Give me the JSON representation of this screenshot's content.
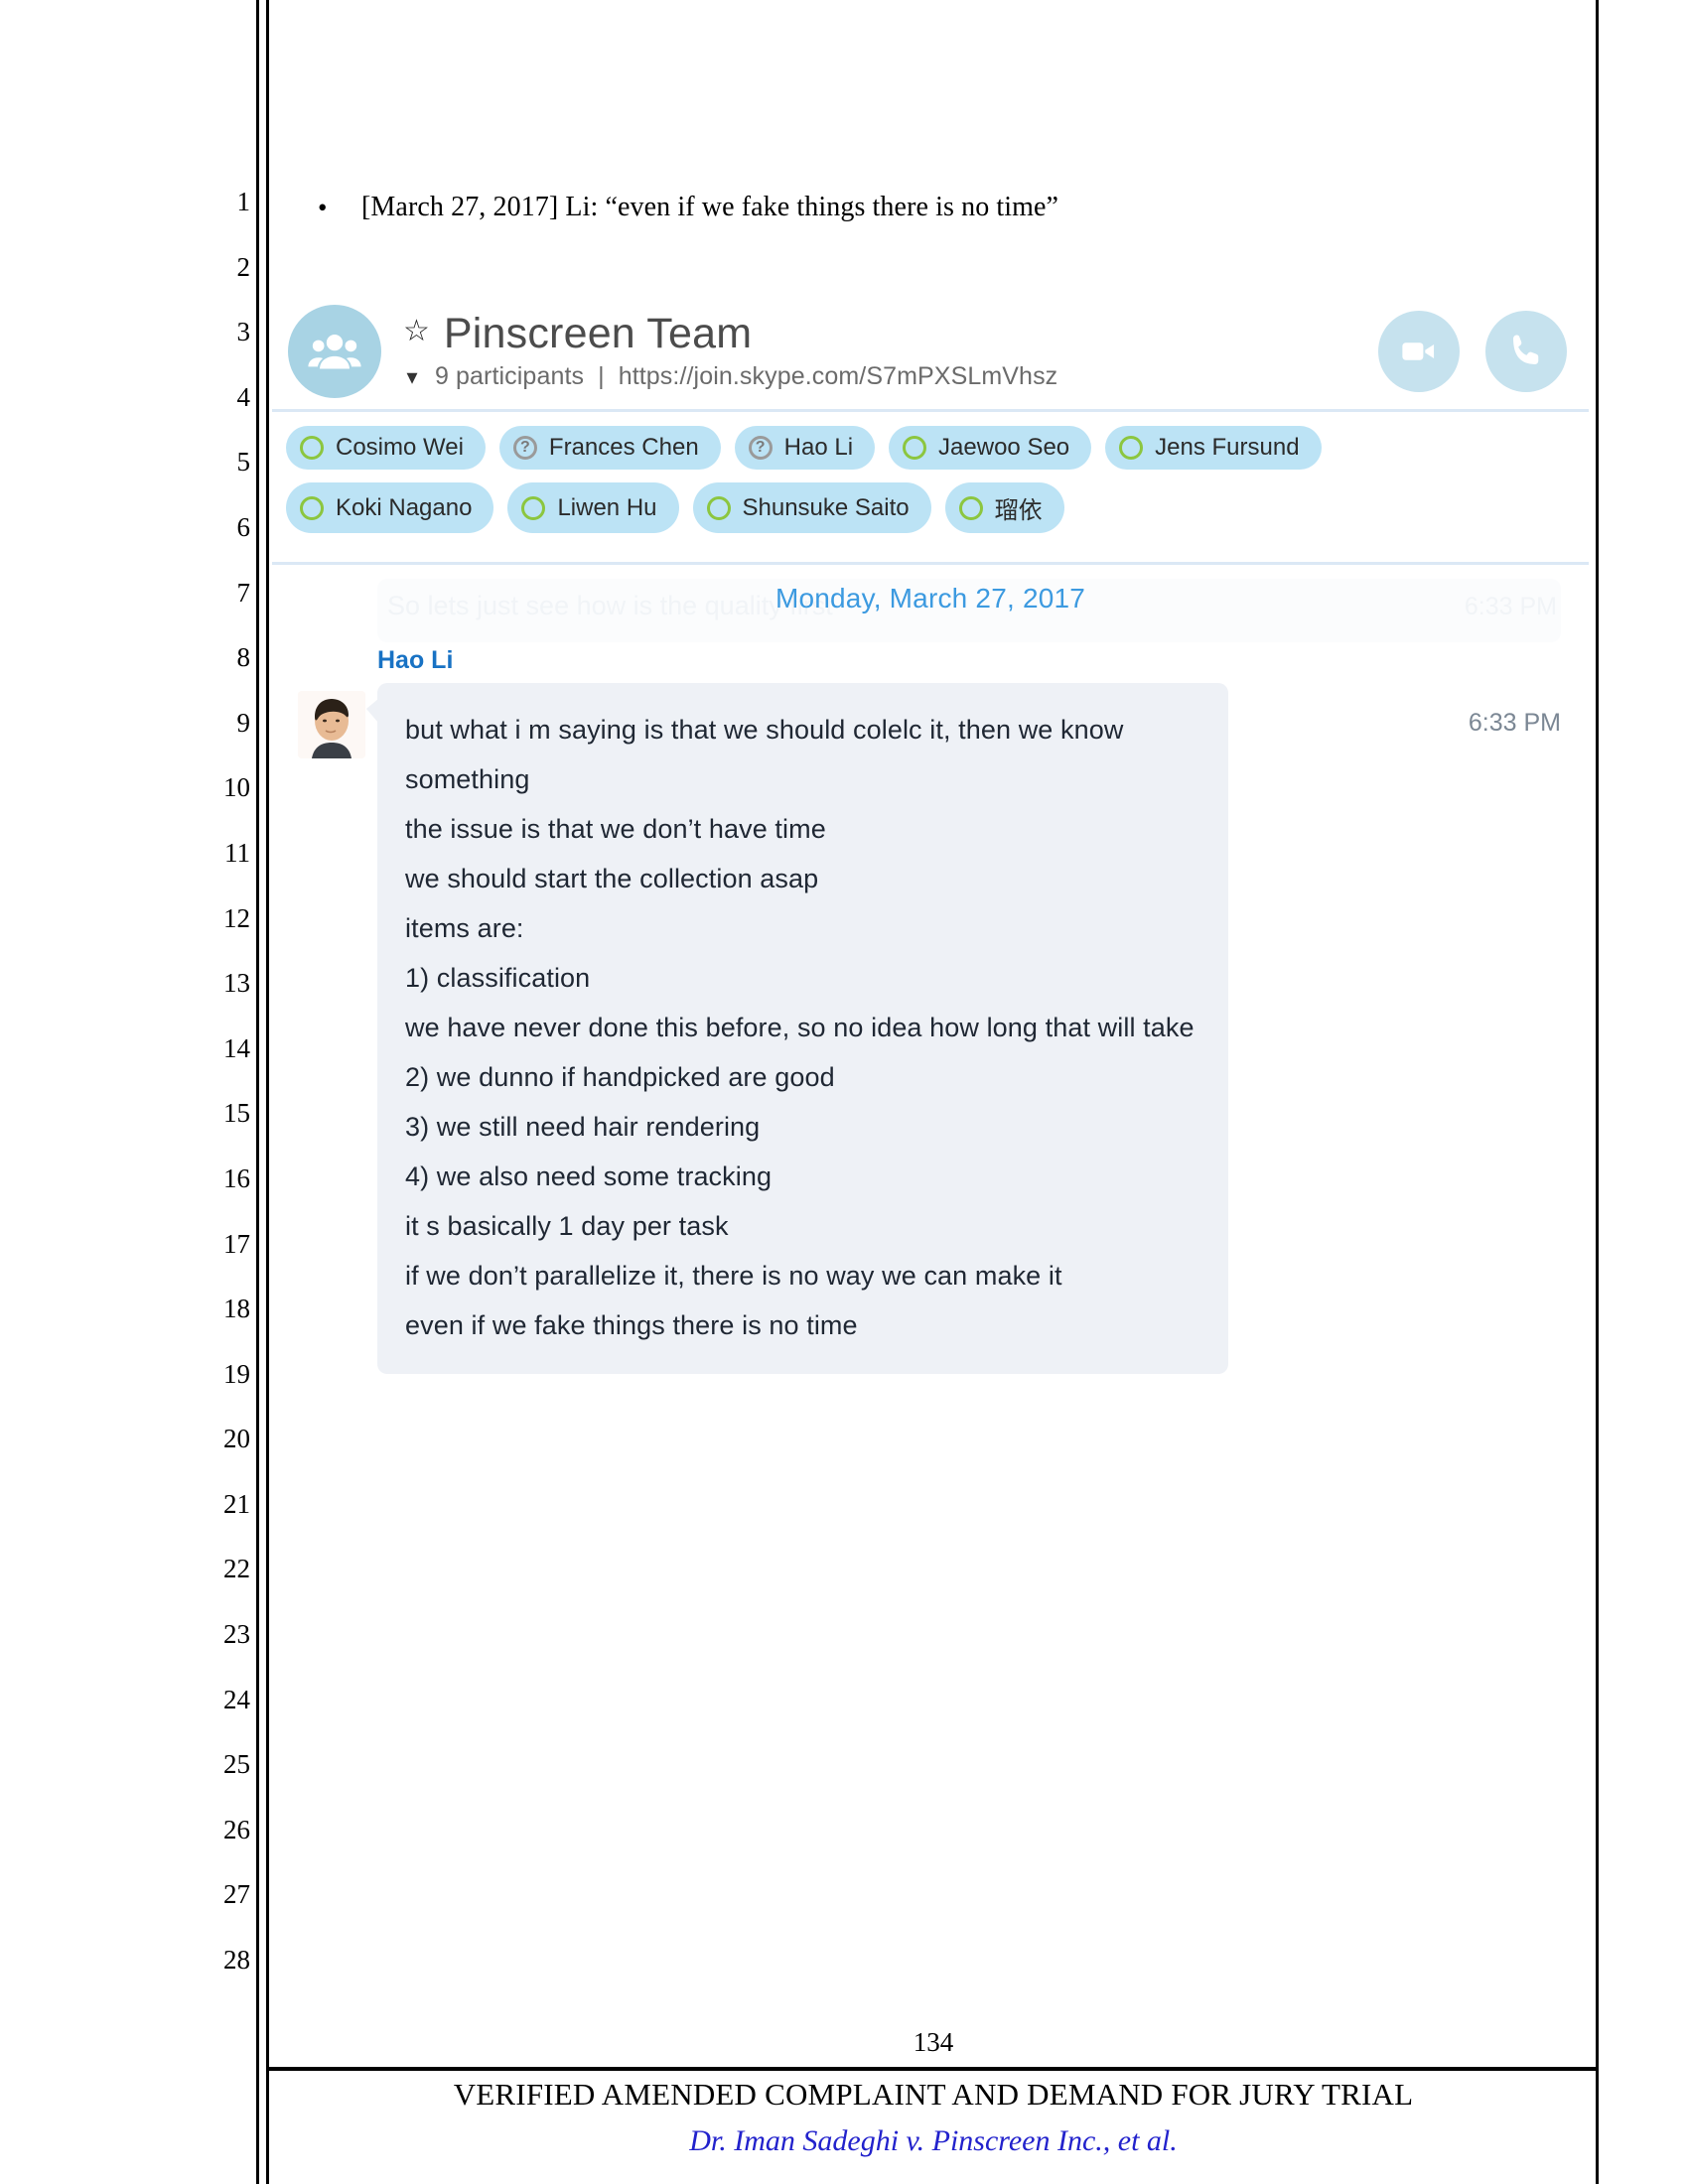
{
  "document": {
    "line_numbers": [
      "1",
      "2",
      "3",
      "4",
      "5",
      "6",
      "7",
      "8",
      "9",
      "10",
      "11",
      "12",
      "13",
      "14",
      "15",
      "16",
      "17",
      "18",
      "19",
      "20",
      "21",
      "22",
      "23",
      "24",
      "25",
      "26",
      "27",
      "28"
    ],
    "bullet_marker": "•",
    "bullet_text": "[March 27, 2017] Li: “even if we fake things there is no time”",
    "page_number": "134",
    "footer_title": "VERIFIED AMENDED COMPLAINT AND DEMAND FOR JURY TRIAL",
    "footer_case": "Dr. Iman Sadeghi v. Pinscreen Inc., et al."
  },
  "skype": {
    "header": {
      "group_avatar_icon": "people-group-icon",
      "favorite_icon": "star-icon",
      "title": "Pinscreen Team",
      "expand_icon": "chevron-down-icon",
      "participants_count_label": "9 participants",
      "separator": "|",
      "join_link": "https://join.skype.com/S7mPXSLmVhsz",
      "video_call_icon": "video-camera-icon",
      "audio_call_icon": "phone-icon"
    },
    "participants_rows": [
      [
        {
          "name": "Cosimo Wei",
          "presence": "online"
        },
        {
          "name": "Frances Chen",
          "presence": "unknown"
        },
        {
          "name": "Hao Li",
          "presence": "unknown"
        },
        {
          "name": "Jaewoo Seo",
          "presence": "online"
        },
        {
          "name": "Jens Fursund",
          "presence": "online"
        }
      ],
      [
        {
          "name": "Koki Nagano",
          "presence": "online"
        },
        {
          "name": "Liwen Hu",
          "presence": "online"
        },
        {
          "name": "Shunsuke Saito",
          "presence": "online"
        },
        {
          "name": "瑠依",
          "presence": "online"
        }
      ]
    ],
    "ghost_message": {
      "text": "So lets just see how is the quality first",
      "time": "6:33 PM"
    },
    "date_divider": "Monday, March 27, 2017",
    "message": {
      "sender": "Hao Li",
      "avatar_icon": "user-photo-avatar",
      "time": "6:33 PM",
      "lines": [
        "but what i m saying is that we should colelc it, then we know",
        "something",
        "the issue is that we don’t have time",
        "we should start the collection asap",
        "items are:",
        "1) classification",
        "we have never done this before, so no idea how long that will take",
        "2) we dunno if handpicked are good",
        "3) we still need hair rendering",
        "4) we also need some tracking",
        "it s basically 1 day per task",
        "if we don’t parallelize it, there is no way we can make it",
        "even if we fake things there is no time"
      ]
    }
  },
  "colors": {
    "skype_blue": "#3c9ae0",
    "sender_blue": "#1872c4",
    "chip_bg": "#bce3f5",
    "presence_green": "#8cc63f",
    "bubble_bg": "#eef1f6",
    "avatar_blue": "#a8d3e4",
    "action_blue": "#c6e2ee",
    "case_blue": "#2222cc"
  }
}
